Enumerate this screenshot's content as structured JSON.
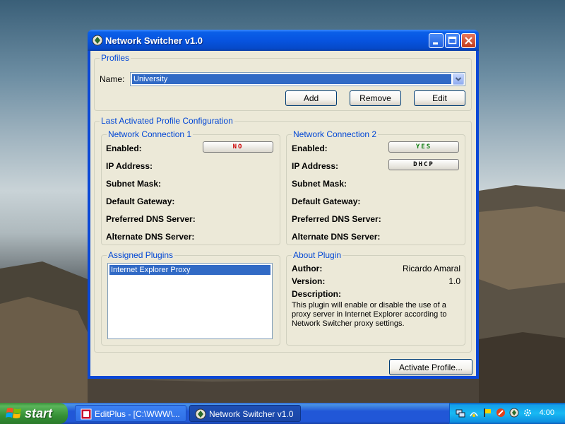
{
  "window": {
    "title": "Network Switcher v1.0"
  },
  "profiles": {
    "group_title": "Profiles",
    "name_label": "Name:",
    "selected_profile": "University",
    "add_label": "Add",
    "remove_label": "Remove",
    "edit_label": "Edit"
  },
  "last_config": {
    "group_title": "Last Activated Profile Configuration",
    "connections": [
      {
        "title": "Network Connection 1",
        "enabled_label": "Enabled:",
        "enabled_value": "NO",
        "enabled_color": "#cc0000",
        "ip_label": "IP Address:",
        "ip_value": "",
        "subnet_label": "Subnet Mask:",
        "gateway_label": "Default Gateway:",
        "pref_dns_label": "Preferred DNS Server:",
        "alt_dns_label": "Alternate DNS Server:"
      },
      {
        "title": "Network Connection 2",
        "enabled_label": "Enabled:",
        "enabled_value": "YES",
        "enabled_color": "#0a7a0a",
        "ip_label": "IP Address:",
        "ip_value": "DHCP",
        "subnet_label": "Subnet Mask:",
        "gateway_label": "Default Gateway:",
        "pref_dns_label": "Preferred DNS Server:",
        "alt_dns_label": "Alternate DNS Server:"
      }
    ]
  },
  "plugins": {
    "group_title": "Assigned Plugins",
    "items": [
      "Internet Explorer Proxy"
    ]
  },
  "about_plugin": {
    "group_title": "About Plugin",
    "author_label": "Author:",
    "author_value": "Ricardo Amaral",
    "version_label": "Version:",
    "version_value": "1.0",
    "description_label": "Description:",
    "description_text": "This plugin will enable or disable the use of a proxy server in Internet Explorer according to Network Switcher proxy settings."
  },
  "footer": {
    "activate_label": "Activate Profile..."
  },
  "taskbar": {
    "start_label": "start",
    "tasks": [
      {
        "label": "EditPlus - [C:\\WWW\\..."
      },
      {
        "label": "Network Switcher v1.0"
      }
    ],
    "clock": "4:00"
  }
}
